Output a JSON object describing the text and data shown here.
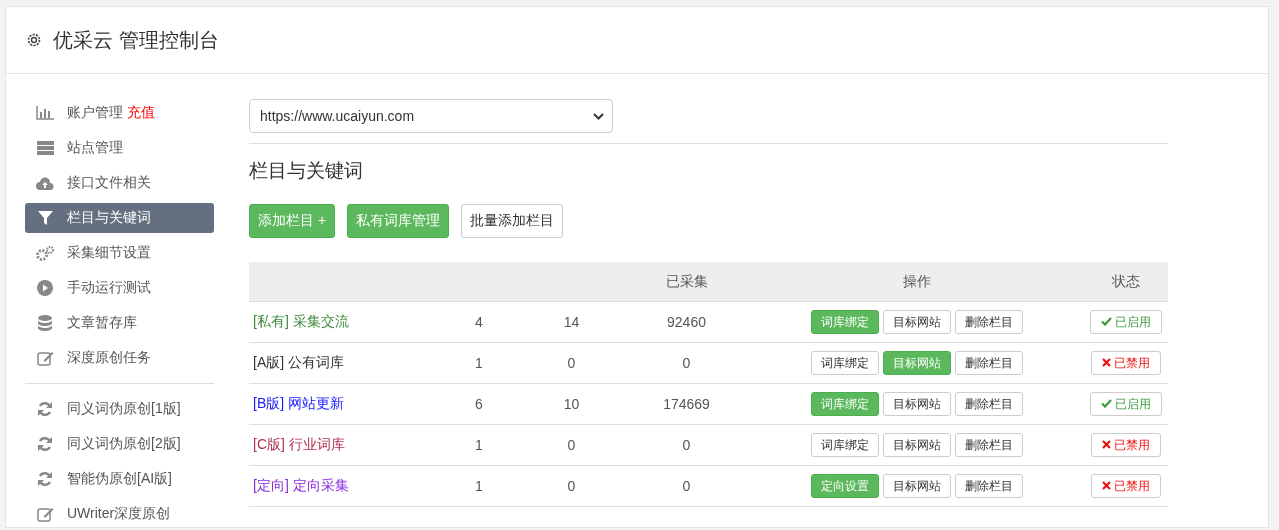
{
  "header": {
    "title": "优采云 管理控制台"
  },
  "sidebar": {
    "groups": [
      {
        "items": [
          {
            "label": "账户管理",
            "tag": "充值",
            "selected": false
          },
          {
            "label": "站点管理",
            "selected": false
          },
          {
            "label": "接口文件相关",
            "selected": false
          },
          {
            "label": "栏目与关键词",
            "selected": true
          },
          {
            "label": "采集细节设置",
            "selected": false
          },
          {
            "label": "手动运行测试",
            "selected": false
          },
          {
            "label": "文章暂存库",
            "selected": false
          },
          {
            "label": "深度原创任务",
            "selected": false
          }
        ]
      },
      {
        "items": [
          {
            "label": "同义词伪原创[1版]",
            "selected": false
          },
          {
            "label": "同义词伪原创[2版]",
            "selected": false
          },
          {
            "label": "智能伪原创[AI版]",
            "selected": false
          },
          {
            "label": "UWriter深度原创",
            "selected": false
          }
        ]
      }
    ]
  },
  "site_select": {
    "value": "https://www.ucaiyun.com"
  },
  "section_title": "栏目与关键词",
  "toolbar": [
    {
      "label": "添加栏目 +",
      "primary": true
    },
    {
      "label": "私有词库管理",
      "primary": true
    },
    {
      "label": "批量添加栏目",
      "primary": false
    }
  ],
  "table": {
    "columns": [
      "",
      "",
      "",
      "已采集",
      "操作",
      "状态"
    ],
    "rows": [
      {
        "prefix": "[私有]",
        "name": "采集交流",
        "color": "#3c8a3c",
        "column_2": "4",
        "column_3": "14",
        "collected": "92460",
        "actions": [
          {
            "label": "词库绑定",
            "primary": true
          },
          {
            "label": "目标网站",
            "primary": false
          },
          {
            "label": "删除栏目",
            "primary": false
          }
        ],
        "status": {
          "label": "已启用",
          "enabled": true
        }
      },
      {
        "prefix": "[A版]",
        "name": "公有词库",
        "color": "#333333",
        "column_2": "1",
        "column_3": "0",
        "collected": "0",
        "actions": [
          {
            "label": "词库绑定",
            "primary": false
          },
          {
            "label": "目标网站",
            "primary": true
          },
          {
            "label": "删除栏目",
            "primary": false
          }
        ],
        "status": {
          "label": "已禁用",
          "enabled": false
        }
      },
      {
        "prefix": "[B版]",
        "name": "网站更新",
        "color": "#1a1aff",
        "column_2": "6",
        "column_3": "10",
        "collected": "174669",
        "actions": [
          {
            "label": "词库绑定",
            "primary": true
          },
          {
            "label": "目标网站",
            "primary": false
          },
          {
            "label": "删除栏目",
            "primary": false
          }
        ],
        "status": {
          "label": "已启用",
          "enabled": true
        }
      },
      {
        "prefix": "[C版]",
        "name": "行业词库",
        "color": "#b03050",
        "column_2": "1",
        "column_3": "0",
        "collected": "0",
        "actions": [
          {
            "label": "词库绑定",
            "primary": false
          },
          {
            "label": "目标网站",
            "primary": false
          },
          {
            "label": "删除栏目",
            "primary": false
          }
        ],
        "status": {
          "label": "已禁用",
          "enabled": false
        }
      },
      {
        "prefix": "[定向]",
        "name": "定向采集",
        "color": "#8a2be2",
        "column_2": "1",
        "column_3": "0",
        "collected": "0",
        "actions": [
          {
            "label": "定向设置",
            "primary": true
          },
          {
            "label": "目标网站",
            "primary": false
          },
          {
            "label": "删除栏目",
            "primary": false
          }
        ],
        "status": {
          "label": "已禁用",
          "enabled": false
        }
      }
    ]
  }
}
